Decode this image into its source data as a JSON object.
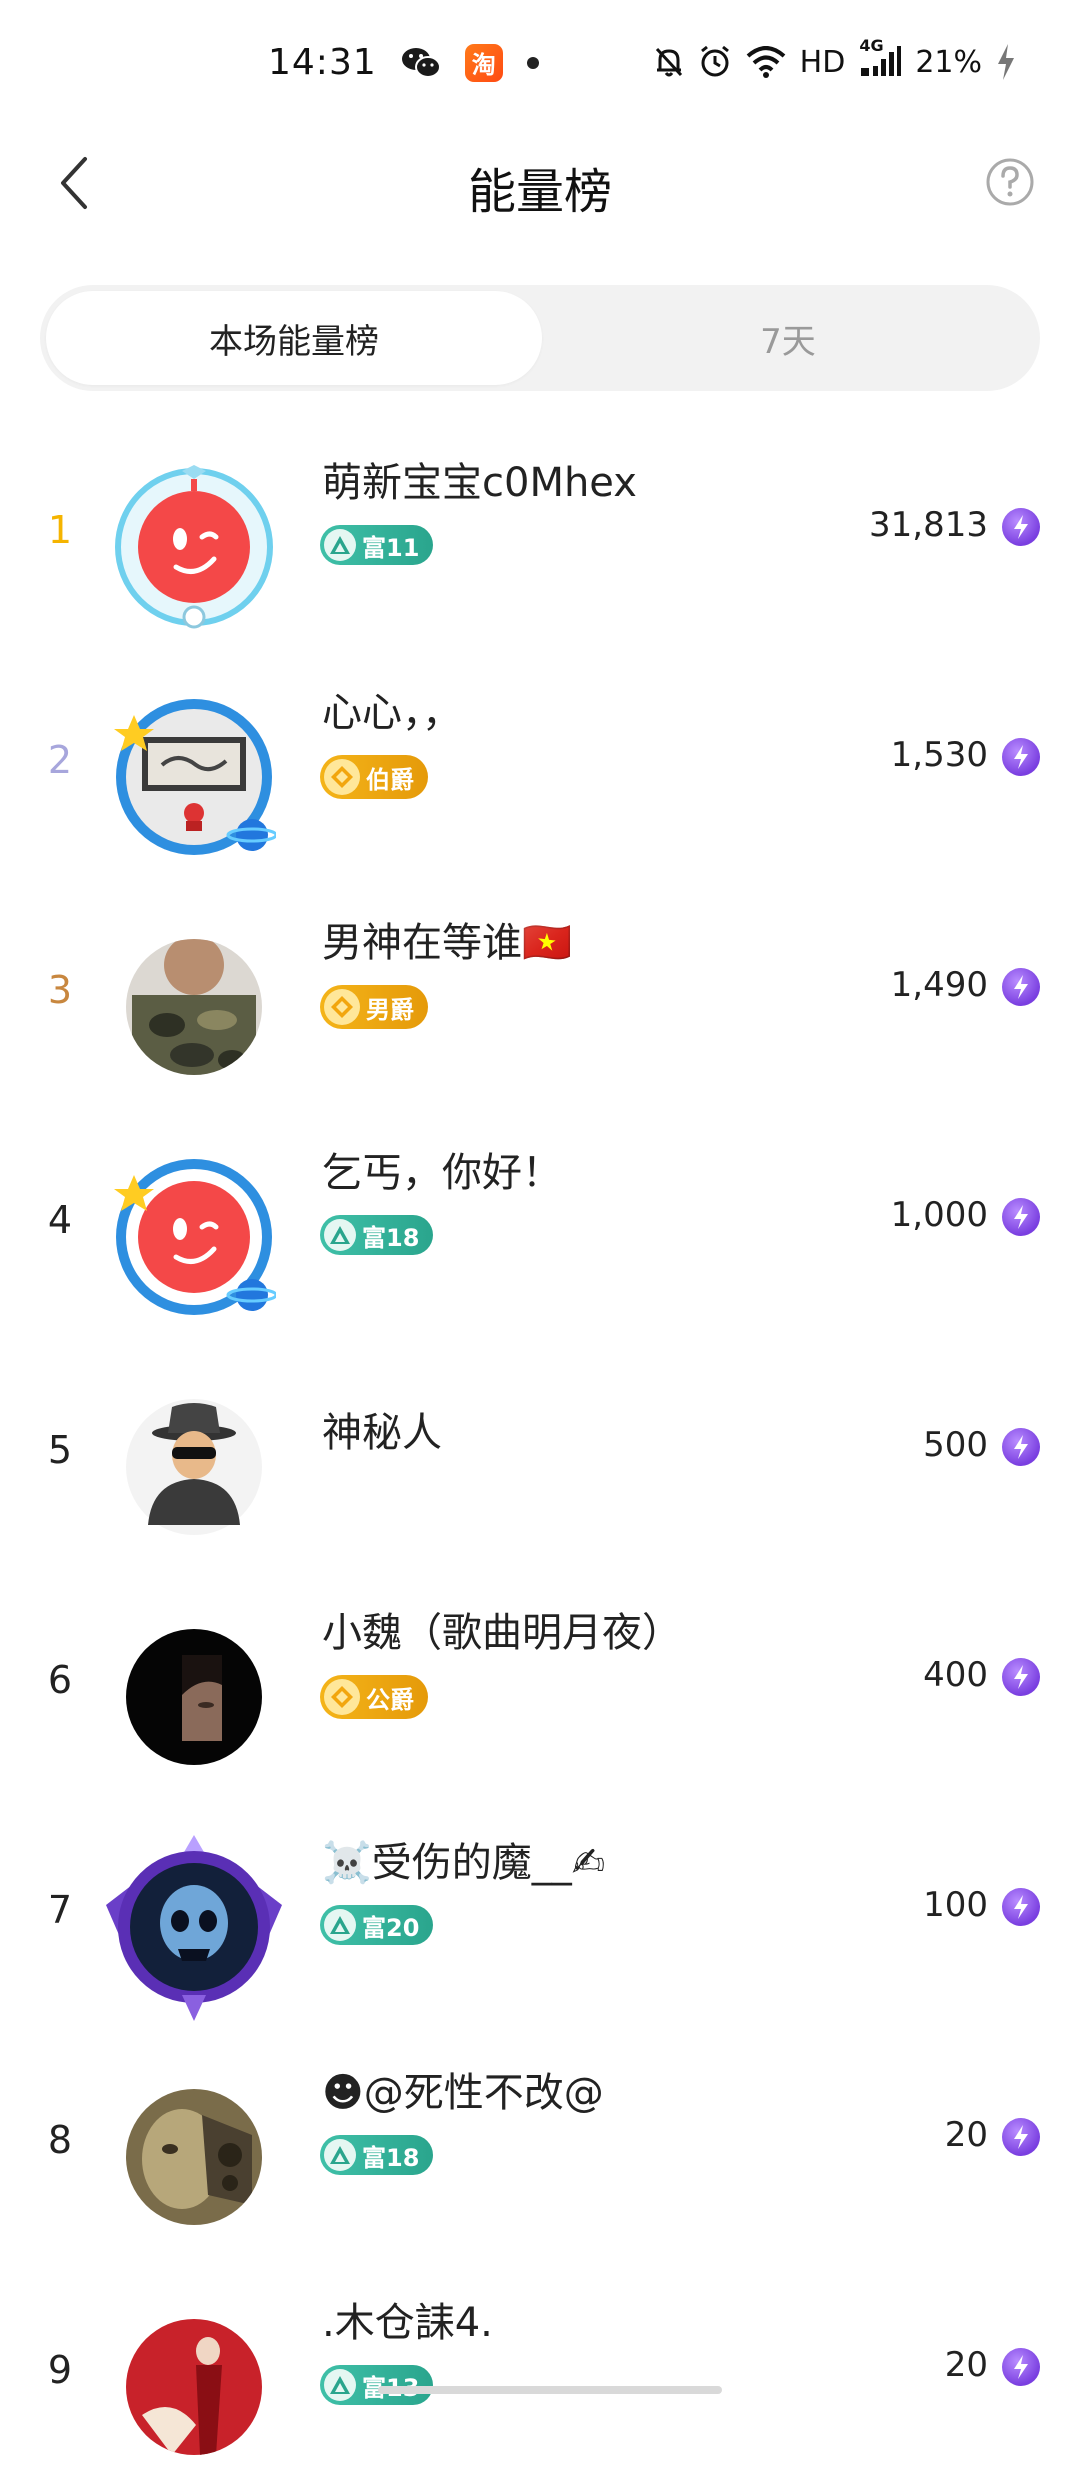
{
  "status_bar": {
    "time": "14:31",
    "taobao_glyph": "淘",
    "network_hd": "HD",
    "network_4g": "4G",
    "battery": "21%"
  },
  "header": {
    "title": "能量榜"
  },
  "tabs": [
    {
      "label": "本场能量榜",
      "active": true
    },
    {
      "label": "7天",
      "active": false
    }
  ],
  "leaderboard": [
    {
      "rank": "1",
      "name": "萌新宝宝c0Mhex",
      "badge": "富11",
      "badge_type": "rich",
      "score": "31,813",
      "avatar": "red-wink-avatar",
      "frame": "cyan-frame"
    },
    {
      "rank": "2",
      "name": "心心，，",
      "badge": "伯爵",
      "badge_type": "noble",
      "score": "1,530",
      "avatar": "photo-avatar",
      "frame": "blue-planet-frame"
    },
    {
      "rank": "3",
      "name": "男神在等谁🇻🇳",
      "badge": "男爵",
      "badge_type": "noble",
      "score": "1,490",
      "avatar": "camo-photo-avatar",
      "frame": "none"
    },
    {
      "rank": "4",
      "name": "乞丐，你好！",
      "badge": "富18",
      "badge_type": "rich",
      "score": "1,000",
      "avatar": "red-wink-avatar",
      "frame": "blue-planet-frame"
    },
    {
      "rank": "5",
      "name": "神秘人",
      "badge": "",
      "badge_type": "none",
      "score": "500",
      "avatar": "mystery-man-avatar",
      "frame": "none"
    },
    {
      "rank": "6",
      "name": "小魏（歌曲明月夜）",
      "badge": "公爵",
      "badge_type": "noble",
      "score": "400",
      "avatar": "dark-portrait-avatar",
      "frame": "none"
    },
    {
      "rank": "7",
      "name": "☠️受伤的魔__✍",
      "badge": "富20",
      "badge_type": "rich",
      "score": "100",
      "avatar": "skull-avatar",
      "frame": "purple-crest-frame"
    },
    {
      "rank": "8",
      "name": "☻@死性不改@",
      "badge": "富18",
      "badge_type": "rich",
      "score": "20",
      "avatar": "mech-face-avatar",
      "frame": "none"
    },
    {
      "rank": "9",
      "name": ".木仓誄4.",
      "badge": "富13",
      "badge_type": "rich",
      "score": "20",
      "avatar": "red-portrait-avatar",
      "frame": "none"
    }
  ],
  "colors": {
    "rank_gold": "#f5b400",
    "rank_silver": "#a7a6dc",
    "rank_bronze": "#c8873f",
    "rich_badge": "#2aa58d",
    "noble_badge": "#e59a0a",
    "energy_icon": "#7a3fe0"
  }
}
